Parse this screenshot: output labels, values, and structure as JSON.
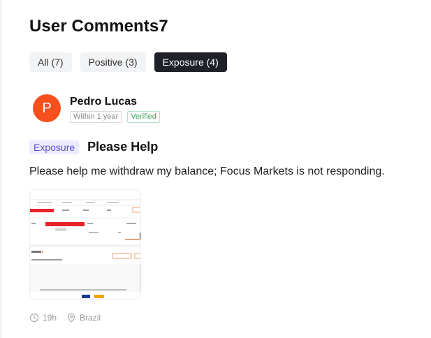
{
  "page": {
    "title": "User Comments7"
  },
  "tabs": [
    {
      "label": "All (7)",
      "active": false
    },
    {
      "label": "Positive (3)",
      "active": false
    },
    {
      "label": "Exposure (4)",
      "active": true
    }
  ],
  "comment": {
    "avatar_letter": "P",
    "author": "Pedro Lucas",
    "badges": {
      "duration": "Within 1 year",
      "verified": "Verified"
    },
    "category": "Exposure",
    "title": "Please Help",
    "body": "Please help me withdraw my balance; Focus Markets is not responding.",
    "attachment": {
      "icon": "screenshot-thumbnail"
    },
    "time": "19h",
    "location": "Brazil"
  },
  "colors": {
    "avatar": "#f5501e",
    "active_tab": "#1e2127",
    "exposure_tag_bg": "#ecebff",
    "exposure_tag_text": "#5b54d6",
    "verified": "#3fa55b"
  }
}
